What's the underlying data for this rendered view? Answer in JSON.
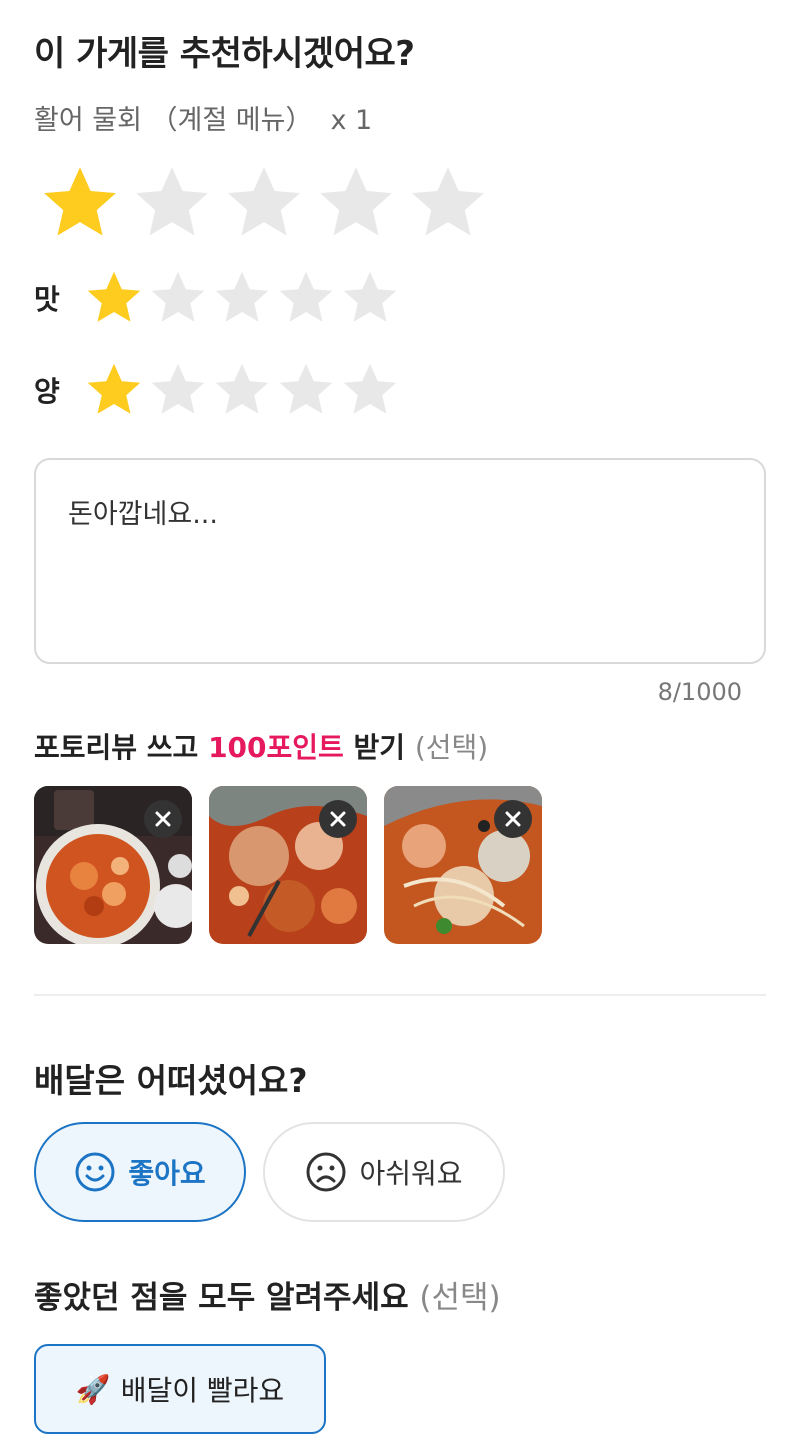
{
  "header": {
    "title": "이 가게를 추천하시겠어요?",
    "menu_item": "활어 물회 （계절 메뉴）",
    "quantity": "x 1"
  },
  "overall_rating": {
    "value": 1,
    "max": 5
  },
  "sub_ratings": [
    {
      "label": "맛",
      "value": 1,
      "max": 5
    },
    {
      "label": "양",
      "value": 1,
      "max": 5
    }
  ],
  "review": {
    "text": "돈아깝네요...",
    "counter": "8/1000"
  },
  "photo_review": {
    "prefix": "포토리뷰 쓰고 ",
    "points": "100포인트",
    "suffix": " 받기 ",
    "optional": "(선택)",
    "photos": [
      {
        "alt": "food-photo-1"
      },
      {
        "alt": "food-photo-2"
      },
      {
        "alt": "food-photo-3"
      }
    ]
  },
  "delivery": {
    "title": "배달은 어떠셨어요?",
    "good_label": "좋아요",
    "bad_label": "아쉬워요",
    "selected": "good"
  },
  "good_points": {
    "title": "좋았던 점을 모두 알려주세요 ",
    "optional": "(선택)",
    "chips": [
      {
        "emoji": "🚀",
        "label": "배달이 빨라요",
        "selected": true
      }
    ]
  },
  "colors": {
    "star_on": "#FDCC1F",
    "star_off": "#E8E8E8",
    "accent_blue": "#1C74C4",
    "points_pink": "#E6195F"
  }
}
